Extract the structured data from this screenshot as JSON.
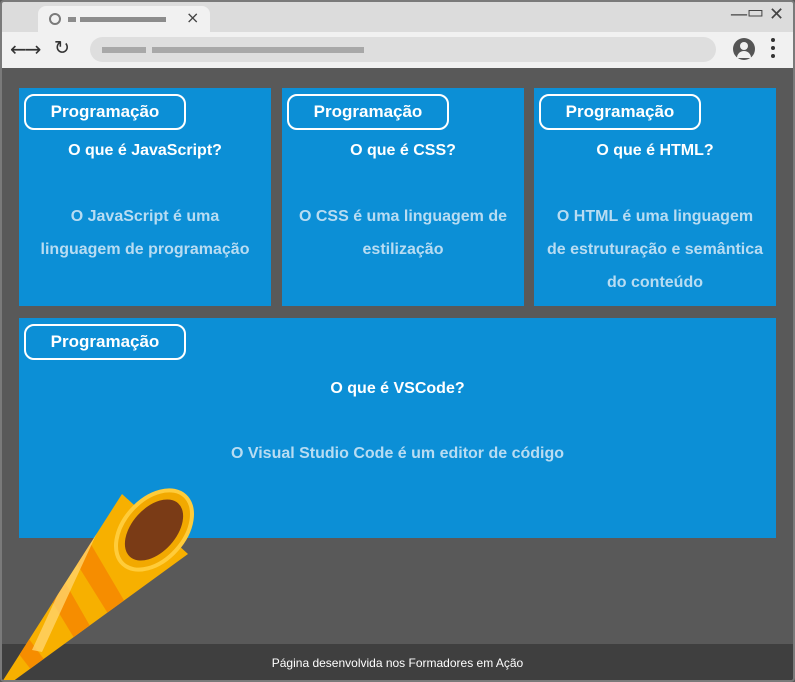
{
  "browser": {
    "controls": {
      "minimize": "—",
      "restore": "▭",
      "close": "✕"
    },
    "tab_close": "×",
    "nav_arrows": "←→",
    "reload": "↻"
  },
  "cards": [
    {
      "badge": "Programação",
      "question": "O que é JavaScript?",
      "answer": "O JavaScript é uma linguagem de programação"
    },
    {
      "badge": "Programação",
      "question": "O que é CSS?",
      "answer": "O CSS é uma linguagem de estilização"
    },
    {
      "badge": "Programação",
      "question": "O que é HTML?",
      "answer": "O HTML é uma linguagem de estruturação e semântica do conteúdo"
    },
    {
      "badge": "Programação",
      "question": "O que é VSCode?",
      "answer": "O Visual Studio Code é um editor de código"
    }
  ],
  "footer": {
    "text": "Página desenvolvida nos Formadores em Ação"
  },
  "icons": [
    "globe-icon",
    "close-icon",
    "back-arrow-icon",
    "forward-arrow-icon",
    "reload-icon",
    "profile-icon",
    "kebab-menu-icon",
    "party-horn-icon"
  ],
  "colors": {
    "card": "#0c8fd6",
    "page": "#595959",
    "footer": "#3f3f3f",
    "answer_text": "#b8dcf2"
  }
}
